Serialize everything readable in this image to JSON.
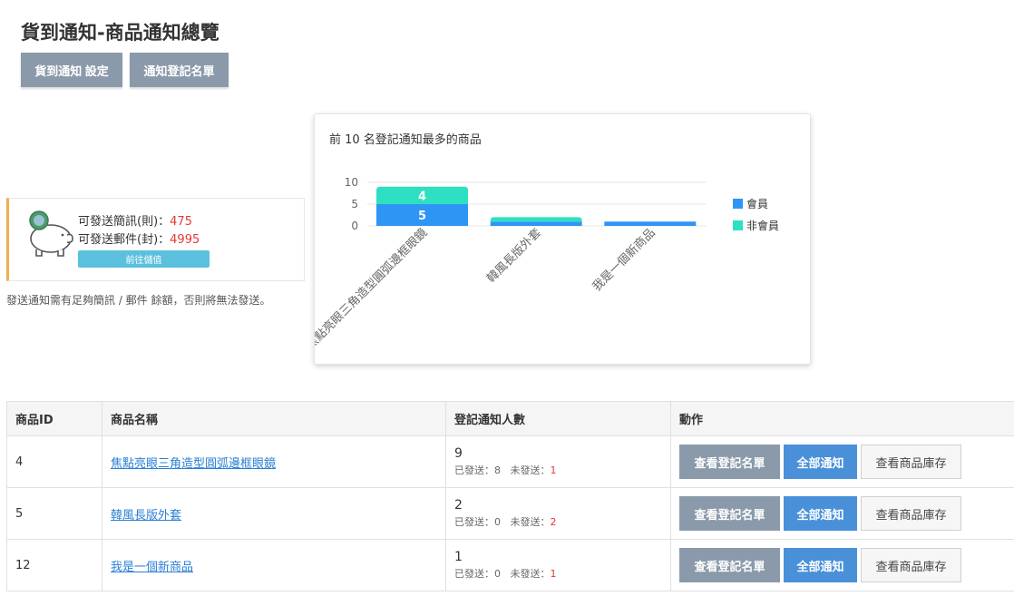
{
  "page": {
    "title": "貨到通知-商品通知總覽",
    "buttons": {
      "settings": "貨到通知 設定",
      "list": "通知登記名單"
    }
  },
  "balance": {
    "sms_label": "可發送簡訊(則)：",
    "sms_value": "475",
    "mail_label": "可發送郵件(封)：",
    "mail_value": "4995",
    "topup_label": "前往儲值",
    "note": "發送通知需有足夠簡訊 / 郵件 餘額，否則將無法發送。",
    "colors": {
      "accent_border": "#f0ad4e",
      "value": "#e53935",
      "topup": "#5bc0de"
    }
  },
  "chart_data": {
    "type": "bar",
    "stacked": true,
    "title": "前 10 名登記通知最多的商品",
    "categories": [
      "焦點亮眼三角造型圓弧邊框眼鏡",
      "韓風長版外套",
      "我是一個新商品"
    ],
    "series": [
      {
        "name": "會員",
        "values": [
          5,
          1,
          1
        ],
        "color": "#2f95f5"
      },
      {
        "name": "非會員",
        "values": [
          4,
          1,
          0
        ],
        "color": "#2de0c2"
      }
    ],
    "data_labels": [
      [
        5,
        null,
        null
      ],
      [
        4,
        null,
        null
      ]
    ],
    "y_ticks": [
      0,
      5,
      10
    ],
    "ylim": [
      0,
      10
    ],
    "legend": "right",
    "grid": true
  },
  "table": {
    "headers": [
      "商品ID",
      "商品名稱",
      "登記通知人數",
      "動作"
    ],
    "sent_label": "已發送：",
    "unsent_label": "未發送：",
    "actions": {
      "view": "查看登記名單",
      "notify": "全部通知",
      "stock": "查看商品庫存"
    },
    "rows": [
      {
        "id": "4",
        "name": "焦點亮眼三角造型圓弧邊框眼鏡",
        "count": "9",
        "sent": "8",
        "unsent": "1"
      },
      {
        "id": "5",
        "name": "韓風長版外套",
        "count": "2",
        "sent": "0",
        "unsent": "2"
      },
      {
        "id": "12",
        "name": "我是一個新商品",
        "count": "1",
        "sent": "0",
        "unsent": "1"
      }
    ]
  }
}
